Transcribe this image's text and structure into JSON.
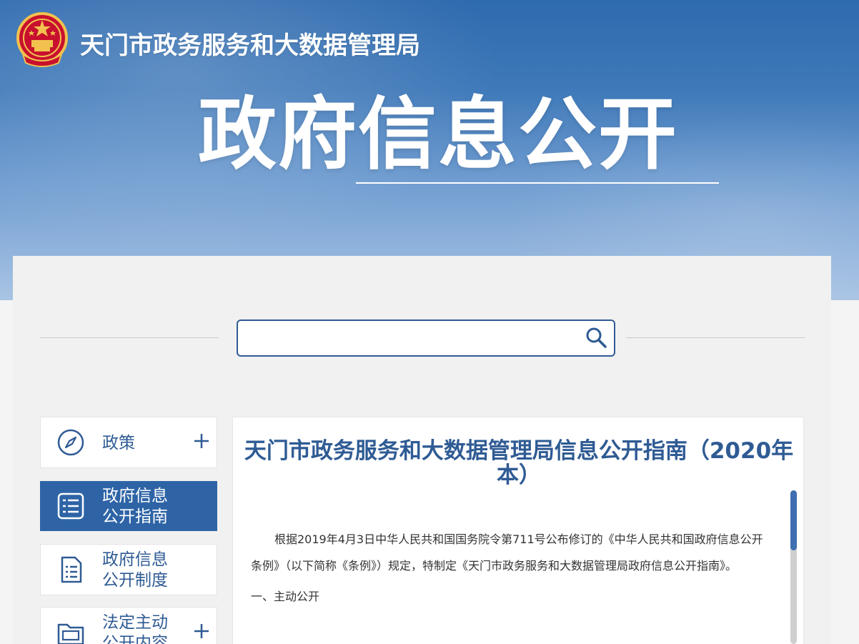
{
  "header": {
    "site_title": "天门市政务服务和大数据管理局",
    "hero_title": "政府信息公开",
    "emblem_icon": "national-emblem-icon"
  },
  "search": {
    "placeholder": "",
    "value": "",
    "icon": "search-icon"
  },
  "sidebar": {
    "items": [
      {
        "label": "政策",
        "icon": "compass-icon",
        "expandable": true,
        "active": false
      },
      {
        "label": "政府信息\n公开指南",
        "icon": "document-list-icon",
        "expandable": false,
        "active": true
      },
      {
        "label": "政府信息\n公开制度",
        "icon": "document-icon",
        "expandable": false,
        "active": false
      },
      {
        "label": "法定主动\n公开内容",
        "icon": "folder-icon",
        "expandable": true,
        "active": false
      }
    ]
  },
  "document": {
    "title": "天门市政务服务和大数据管理局信息公开指南（2020年本）",
    "paragraph_1": "根据2019年4月3日中华人民共和国国务院令第711号公布修订的《中华人民共和国政府信息公开条例》（以下简称《条例》）规定，特制定《天门市政务服务和大数据管理局政府信息公开指南》。",
    "section_1": "一、主动公开"
  },
  "colors": {
    "accent": "#2e64a6",
    "title_blue": "#2f5b94",
    "banner_top": "#2e6aae",
    "panel_bg": "#f1f1f1"
  }
}
